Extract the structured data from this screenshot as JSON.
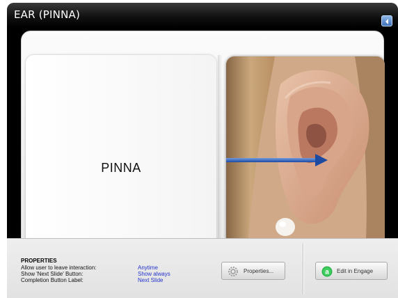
{
  "window": {
    "title": "EAR (PINNA)",
    "nav_icon": "next-slide-icon",
    "accent": "#3d6fb8"
  },
  "slide": {
    "label": "PINNA",
    "image_icon": "ear-photo",
    "arrow_color": "#2a5fb8"
  },
  "properties": {
    "heading": "PROPERTIES",
    "rows": [
      {
        "key": "Allow user to leave interaction:",
        "value": "Anytime"
      },
      {
        "key": "Show 'Next Slide' Button:",
        "value": "Show always"
      },
      {
        "key": "Completion Button Label:",
        "value": "Next Slide"
      }
    ],
    "value_color": "#2233cc"
  },
  "buttons": {
    "properties_label": "Properties...",
    "properties_icon": "gear-icon",
    "engage_label": "Edit in Engage",
    "engage_icon": "engage-logo-icon",
    "engage_icon_color": "#2bb34b"
  }
}
